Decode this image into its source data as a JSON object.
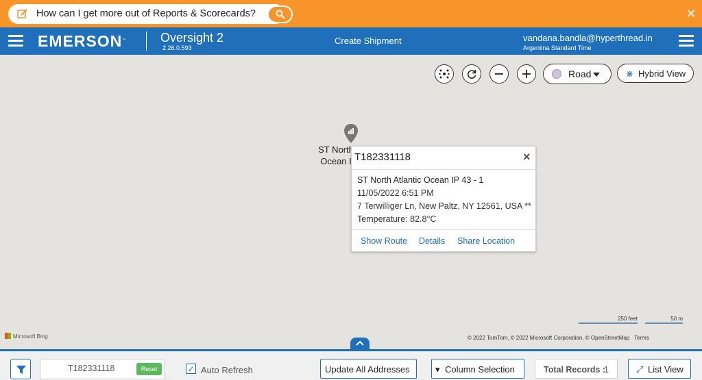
{
  "banner": {
    "question": "How can I get more out of Reports & Scorecards?"
  },
  "header": {
    "logo": "EMERSON",
    "logo_tm": "™",
    "app_name": "Oversight 2",
    "app_version": "2.26.0.593",
    "create_shipment": "Create Shipment",
    "user_email": "vandana.bandla@hyperthread.in",
    "user_timezone": "Argentina Standard Time"
  },
  "map": {
    "road_label": "Road",
    "hybrid_label": "Hybrid View",
    "pin_label_line1": "ST North",
    "pin_label_line2": "Ocean I",
    "popup": {
      "title": "T182331118",
      "name": "ST North Atlantic Ocean IP 43 - 1",
      "datetime": "11/05/2022 6:51 PM",
      "address": "7 Terwilliger Ln, New Paltz, NY 12561, USA **",
      "temperature": "Temperature: 82.8°C",
      "links": {
        "show_route": "Show Route",
        "details": "Details",
        "share_location": "Share Location"
      }
    },
    "attribution_bing": "Microsoft Bing",
    "scale_feet": "250 feet",
    "scale_m": "50 m",
    "copyright": "© 2022 TomTom, © 2022 Microsoft Corporation, © OpenStreetMap",
    "terms": "Terms"
  },
  "bottom": {
    "search_value": "T182331118",
    "reset_label": "Reset",
    "auto_refresh_label": "Auto Refresh",
    "auto_refresh_checked": true,
    "update_all_label": "Update All Addresses",
    "column_selection_label": "Column Selection",
    "total_records_label": "Total Records :",
    "total_records_value": "1",
    "list_view_label": "List View"
  },
  "colors": {
    "banner": "#f7942a",
    "header": "#1f6fba",
    "map_bg": "#e5e3df",
    "reset_green": "#5cb85c"
  }
}
